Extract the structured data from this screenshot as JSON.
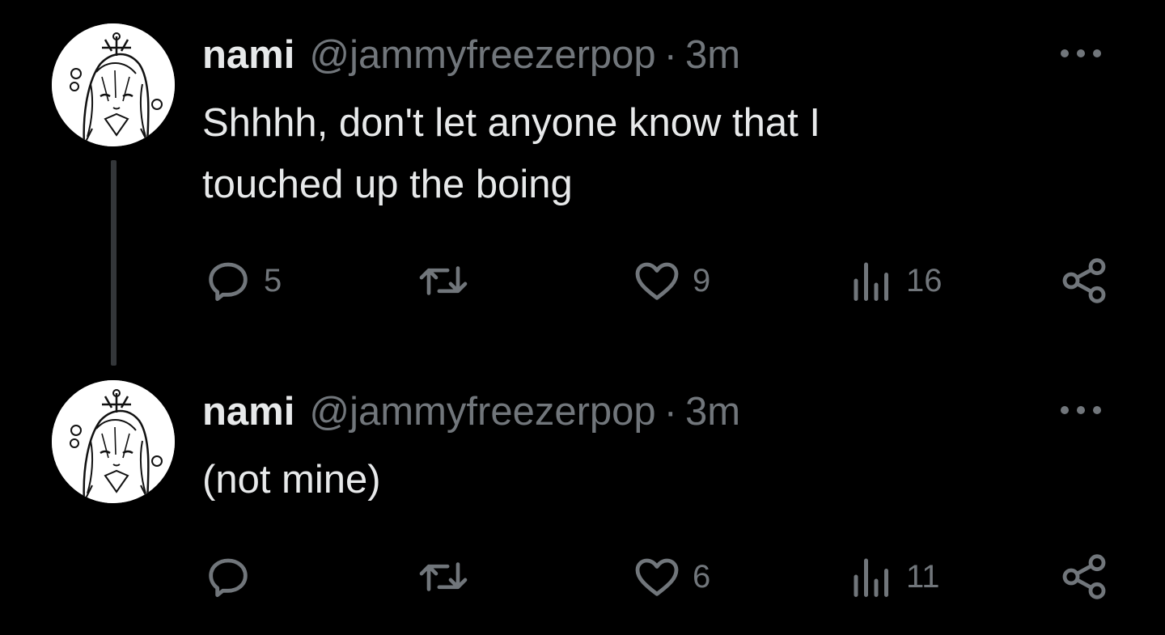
{
  "tweets": [
    {
      "display_name": "nami",
      "handle": "@jammyfreezerpop",
      "separator": "·",
      "time": "3m",
      "text": "Shhhh, don't let anyone know that I\ntouched up the boing",
      "actions": {
        "replies": "5",
        "retweets": "",
        "likes": "9",
        "views": "16"
      }
    },
    {
      "display_name": "nami",
      "handle": "@jammyfreezerpop",
      "separator": "·",
      "time": "3m",
      "text": "(not mine)",
      "actions": {
        "replies": "",
        "retweets": "",
        "likes": "6",
        "views": "11"
      }
    }
  ],
  "icons": {
    "reply": "reply-icon",
    "retweet": "retweet-icon",
    "like": "heart-icon",
    "views": "views-icon",
    "share": "share-icon",
    "more": "more-dots-icon"
  },
  "colors": {
    "background": "#000000",
    "text_primary": "#e7e9ea",
    "text_secondary": "#71767b",
    "thread_line": "#333639"
  }
}
